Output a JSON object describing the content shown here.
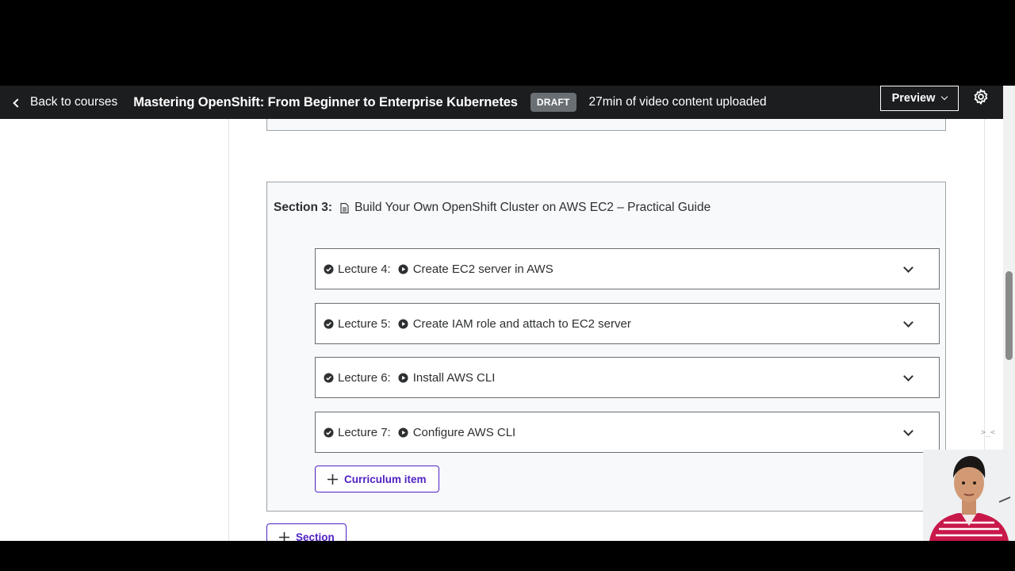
{
  "header": {
    "back_label": "Back to courses",
    "course_title": "Mastering OpenShift: From Beginner to Enterprise Kubernetes",
    "status_badge": "DRAFT",
    "upload_status": "27min of video content uploaded",
    "preview_label": "Preview"
  },
  "section": {
    "number_label": "Section 3:",
    "title": "Build Your Own OpenShift Cluster on AWS EC2 – Practical Guide",
    "lectures": [
      {
        "label": "Lecture 4:",
        "title": "Create EC2 server in AWS"
      },
      {
        "label": "Lecture 5:",
        "title": "Create IAM role and attach to EC2 server"
      },
      {
        "label": "Lecture 6:",
        "title": "Install AWS CLI"
      },
      {
        "label": "Lecture 7:",
        "title": "Configure AWS CLI"
      }
    ],
    "add_item_label": "Curriculum item"
  },
  "add_section_label": "Section",
  "colors": {
    "header_bg": "#1c1d1f",
    "accent_purple": "#5022c3",
    "section_bg": "#f7f9fa",
    "badge_bg": "#6a6f73"
  },
  "icons": {
    "back": "chevron-left-icon",
    "preview_dropdown": "chevron-down-icon",
    "settings": "gear-icon",
    "section_doc": "document-icon",
    "lecture_complete": "check-circle-icon",
    "lecture_video": "play-circle-icon",
    "expand": "chevron-down-icon",
    "add": "plus-icon"
  }
}
